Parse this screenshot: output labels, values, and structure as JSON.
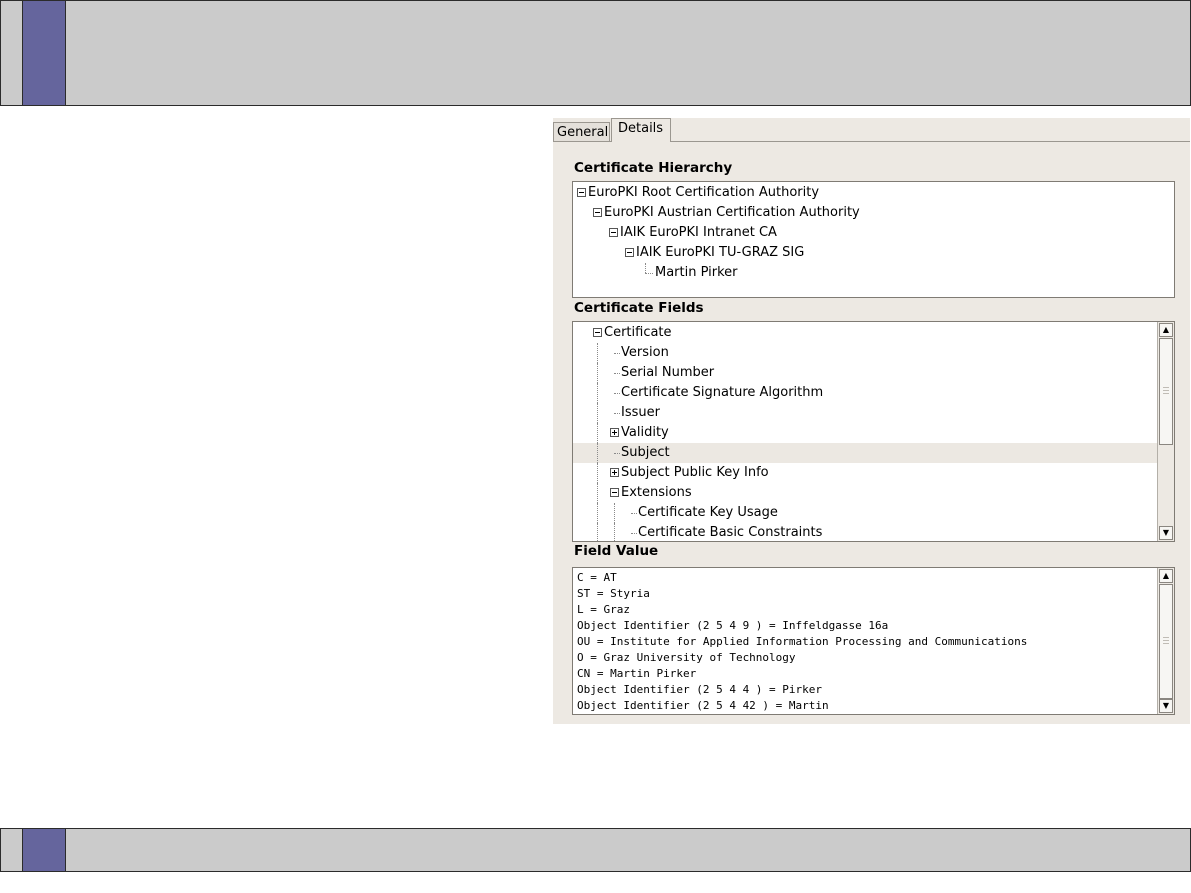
{
  "tabs": {
    "general": "General",
    "details": "Details"
  },
  "hierarchy": {
    "label": "Certificate Hierarchy",
    "items": [
      {
        "text": "EuroPKI Root Certification Authority",
        "expander": "minus"
      },
      {
        "text": "EuroPKI Austrian Certification Authority",
        "expander": "minus"
      },
      {
        "text": "IAIK EuroPKI Intranet CA",
        "expander": "minus"
      },
      {
        "text": "IAIK EuroPKI TU-GRAZ SIG",
        "expander": "minus"
      },
      {
        "text": "Martin Pirker",
        "expander": "none"
      }
    ]
  },
  "fields": {
    "label": "Certificate Fields",
    "selected": "Subject",
    "items": [
      {
        "text": "Certificate",
        "expander": "minus"
      },
      {
        "text": "Version",
        "expander": "none"
      },
      {
        "text": "Serial Number",
        "expander": "none"
      },
      {
        "text": "Certificate Signature Algorithm",
        "expander": "none"
      },
      {
        "text": "Issuer",
        "expander": "none"
      },
      {
        "text": "Validity",
        "expander": "plus"
      },
      {
        "text": "Subject",
        "expander": "none"
      },
      {
        "text": "Subject Public Key Info",
        "expander": "plus"
      },
      {
        "text": "Extensions",
        "expander": "minus"
      },
      {
        "text": "Certificate Key Usage",
        "expander": "none"
      },
      {
        "text": "Certificate Basic Constraints",
        "expander": "none"
      }
    ],
    "scroll_position": 0.0
  },
  "value": {
    "label": "Field Value",
    "lines": [
      "C = AT",
      "ST = Styria",
      "L = Graz",
      "Object Identifier (2 5 4 9 ) = Inffeldgasse 16a",
      "OU = Institute for Applied Information Processing and Communications",
      "O = Graz University of Technology",
      "CN = Martin Pirker",
      "Object Identifier (2 5 4 4 ) = Pirker",
      "Object Identifier (2 5 4 42 ) = Martin"
    ],
    "scroll_position": 0.0
  },
  "icons": {
    "scroll_up": "up-arrow-icon",
    "scroll_down": "down-arrow-icon",
    "expand": "plus-box-icon",
    "collapse": "minus-box-icon"
  },
  "colors": {
    "frame_bar": "#cbcbcb",
    "frame_accent": "#65659d",
    "dialog_bg": "#ede9e3"
  }
}
